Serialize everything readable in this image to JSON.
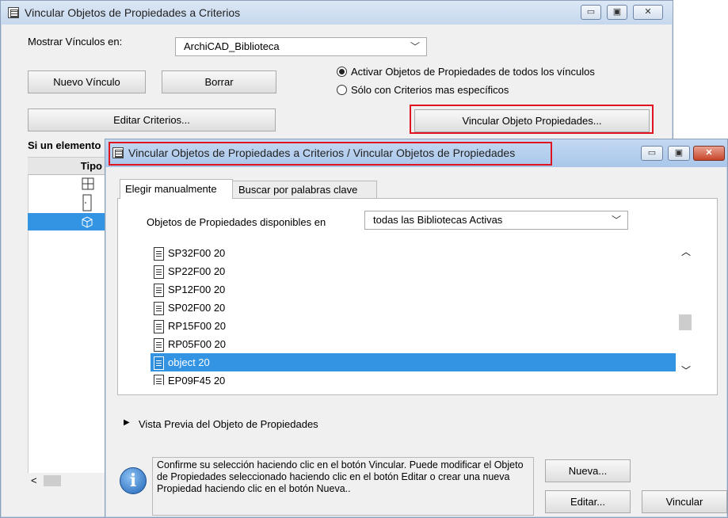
{
  "back_window": {
    "title": "Vincular Objetos de Propiedades a Criterios",
    "controls": {
      "minimize": "▭",
      "maximize": "▣",
      "close": "✕"
    },
    "show_links_label": "Mostrar Vínculos en:",
    "show_links_value": "ArchiCAD_Biblioteca",
    "new_link_button": "Nuevo Vínculo",
    "delete_button": "Borrar",
    "radio_all": "Activar Objetos de Propiedades de todos los vínculos",
    "radio_specific": "Sólo con Criterios mas específicos",
    "edit_criteria_button": "Editar Criterios...",
    "link_object_button": "Vincular Objeto Propiedades...",
    "if_element_label": "Si un elemento",
    "type_column": "Tipo",
    "scroll_left": "<"
  },
  "front_window": {
    "title": "Vincular Objetos de Propiedades a Criterios / Vincular Objetos de Propiedades",
    "controls": {
      "minimize": "▭",
      "maximize": "▣",
      "close": "✕"
    },
    "tabs": [
      {
        "label": "Elegir manualmente"
      },
      {
        "label": "Buscar por palabras clave"
      }
    ],
    "available_label": "Objetos de Propiedades disponibles en",
    "available_value": "todas las Bibliotecas Activas",
    "items": [
      {
        "label": "SP32F00 20"
      },
      {
        "label": "SP22F00 20"
      },
      {
        "label": "SP12F00 20"
      },
      {
        "label": "SP02F00 20"
      },
      {
        "label": "RP15F00 20"
      },
      {
        "label": "RP05F00 20"
      },
      {
        "label": "object 20"
      },
      {
        "label": "EP09F45 20"
      }
    ],
    "preview_label": "Vista Previa del Objeto de Propiedades",
    "info_text": "Confirme su selección haciendo clic en el botón Vincular. Puede modificar el Objeto de Propiedades seleccionado haciendo clic en el botón Editar o crear una nueva Propiedad haciendo clic en el botón Nueva..",
    "new_button": "Nueva...",
    "edit_button": "Editar...",
    "link_button": "Vincular"
  }
}
